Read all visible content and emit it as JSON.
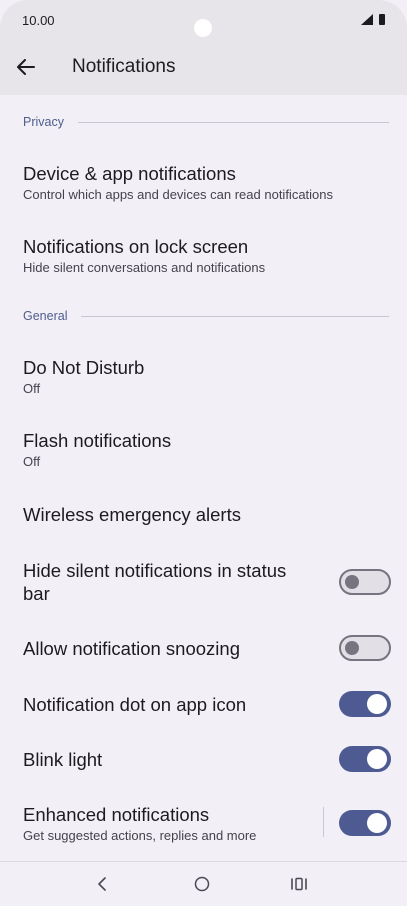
{
  "status_bar": {
    "time": "10.00"
  },
  "app_bar": {
    "title": "Notifications"
  },
  "sections": {
    "privacy": "Privacy",
    "general": "General"
  },
  "items": {
    "device_app": {
      "title": "Device & app notifications",
      "subtitle": "Control which apps and devices can read notifications"
    },
    "lock_screen": {
      "title": "Notifications on lock screen",
      "subtitle": "Hide silent conversations and notifications"
    },
    "dnd": {
      "title": "Do Not Disturb",
      "subtitle": "Off"
    },
    "flash": {
      "title": "Flash notifications",
      "subtitle": "Off"
    },
    "wireless": {
      "title": "Wireless emergency alerts"
    },
    "hide_silent": {
      "title_line1": "Hide silent notifications in status",
      "title_line2": "bar",
      "toggle": "off"
    },
    "snoozing": {
      "title": "Allow notification snoozing",
      "toggle": "off"
    },
    "dot": {
      "title": "Notification dot on app icon",
      "toggle": "on"
    },
    "blink": {
      "title": "Blink light",
      "toggle": "on"
    },
    "enhanced": {
      "title": "Enhanced notifications",
      "subtitle": "Get suggested actions, replies and more",
      "toggle": "on"
    }
  },
  "colors": {
    "accent": "#4e5a92",
    "section_text": "#4e5d8f",
    "background": "#f3eff6",
    "bar": "#e8e5ea"
  },
  "icons": {
    "back": "arrow-left-icon",
    "nav_back": "chevron-left-icon",
    "nav_home": "circle-home-icon",
    "nav_recents": "recents-icon"
  }
}
